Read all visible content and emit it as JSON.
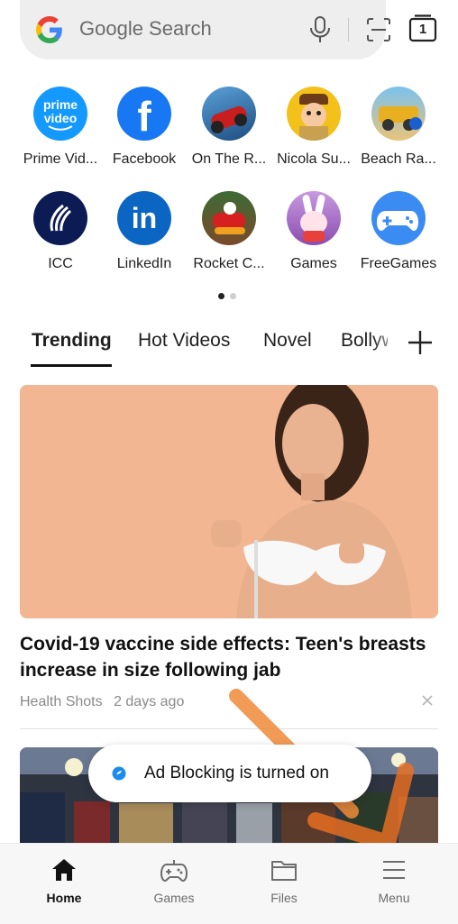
{
  "search": {
    "placeholder": "Google Search",
    "tab_count": "1"
  },
  "shortcuts": [
    {
      "label": "Prime Vid...",
      "icon": "prime-video-icon",
      "color": "#1399ff"
    },
    {
      "label": "Facebook",
      "icon": "facebook-icon",
      "color": "#1877f2"
    },
    {
      "label": "On The R...",
      "icon": "motorbike-race-icon",
      "color": "#2d6aa0"
    },
    {
      "label": "Nicola Su...",
      "icon": "cartoon-character-icon",
      "color": "#f4b81a"
    },
    {
      "label": "Beach Ra...",
      "icon": "beach-racing-car-icon",
      "color": "#e0a020"
    },
    {
      "label": "ICC",
      "icon": "icc-icon",
      "color": "#0d1b55"
    },
    {
      "label": "LinkedIn",
      "icon": "linkedin-icon",
      "color": "#0a66c2"
    },
    {
      "label": "Rocket C...",
      "icon": "rocket-car-icon",
      "color": "#3a5a2a"
    },
    {
      "label": "Games",
      "icon": "bunny-game-icon",
      "color": "#b77cc8"
    },
    {
      "label": "FreeGames",
      "icon": "gamepad-icon",
      "color": "#3b8cf2"
    }
  ],
  "news_tabs": [
    {
      "label": "Trending",
      "active": true
    },
    {
      "label": "Hot Videos",
      "active": false
    },
    {
      "label": "Novel",
      "active": false
    },
    {
      "label": "Bollywood",
      "active": false
    }
  ],
  "article": {
    "headline": "Covid-19 vaccine side effects: Teen's breasts increase in size following jab",
    "source": "Health Shots",
    "time": "2 days ago"
  },
  "toast": {
    "text": "Ad Blocking is turned on"
  },
  "bottom_nav": [
    {
      "label": "Home",
      "icon": "home-icon",
      "active": true
    },
    {
      "label": "Games",
      "icon": "gamepad-icon",
      "active": false
    },
    {
      "label": "Files",
      "icon": "folder-icon",
      "active": false
    },
    {
      "label": "Menu",
      "icon": "hamburger-menu-icon",
      "active": false
    }
  ],
  "colors": {
    "accent_blue": "#1a73e8",
    "text_primary": "#111111",
    "text_secondary": "#8a8a8a",
    "overlay_arrow": "#f07a2a"
  }
}
